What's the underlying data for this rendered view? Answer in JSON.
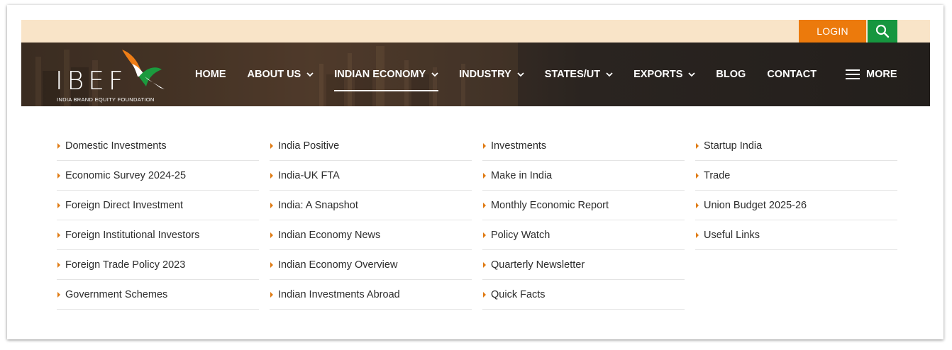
{
  "colors": {
    "topbar_bg": "#f9e4c8",
    "login_bg": "#ec7a0c",
    "search_bg": "#16963f",
    "nav_bg": "#2a2420",
    "link_arrow": "#e07b13"
  },
  "topbar": {
    "login_label": "LOGIN",
    "search_icon": "search-icon"
  },
  "logo": {
    "title": "IBEF",
    "subtitle": "INDIA BRAND EQUITY FOUNDATION"
  },
  "nav": {
    "items": [
      {
        "label": "HOME",
        "dropdown": false
      },
      {
        "label": "ABOUT US",
        "dropdown": true
      },
      {
        "label": "INDIAN ECONOMY",
        "dropdown": true,
        "active": true
      },
      {
        "label": "INDUSTRY",
        "dropdown": true
      },
      {
        "label": "STATES/UT",
        "dropdown": true
      },
      {
        "label": "EXPORTS",
        "dropdown": true
      },
      {
        "label": "BLOG",
        "dropdown": false
      },
      {
        "label": "CONTACT",
        "dropdown": false
      }
    ],
    "more_label": "MORE"
  },
  "menu": {
    "columns": [
      [
        "Domestic Investments",
        "Economic Survey 2024-25",
        "Foreign Direct Investment",
        "Foreign Institutional Investors",
        "Foreign Trade Policy 2023",
        "Government Schemes"
      ],
      [
        "India Positive",
        "India-UK FTA",
        "India: A Snapshot",
        "Indian Economy News",
        "Indian Economy Overview",
        "Indian Investments Abroad"
      ],
      [
        "Investments",
        "Make in India",
        "Monthly Economic Report",
        "Policy Watch",
        "Quarterly Newsletter",
        "Quick Facts"
      ],
      [
        "Startup India",
        "Trade",
        "Union Budget 2025-26",
        "Useful Links"
      ]
    ]
  }
}
